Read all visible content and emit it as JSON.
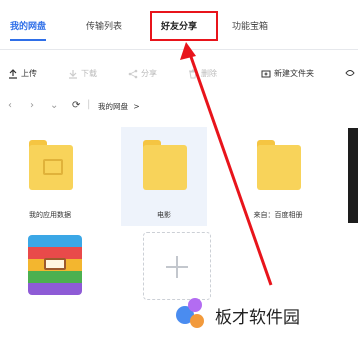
{
  "tabs": {
    "my_disk": "我的网盘",
    "transfer_list": "传输列表",
    "friend_share": "好友分享",
    "tools": "功能宝箱"
  },
  "toolbar": {
    "upload": "上传",
    "download": "下载",
    "share": "分享",
    "delete": "删除",
    "new_folder": "新建文件夹"
  },
  "breadcrumb": {
    "current": "我的网盘",
    "separator": ">"
  },
  "files": [
    {
      "name": "我的应用数据",
      "type": "folder"
    },
    {
      "name": "电影",
      "type": "folder"
    },
    {
      "name": "来自：百度相册",
      "type": "folder"
    }
  ],
  "watermark": {
    "text": "板才软件园"
  },
  "colors": {
    "accent": "#2f6fe8",
    "annotation": "#e8141b",
    "folder": "#f8d35a"
  }
}
